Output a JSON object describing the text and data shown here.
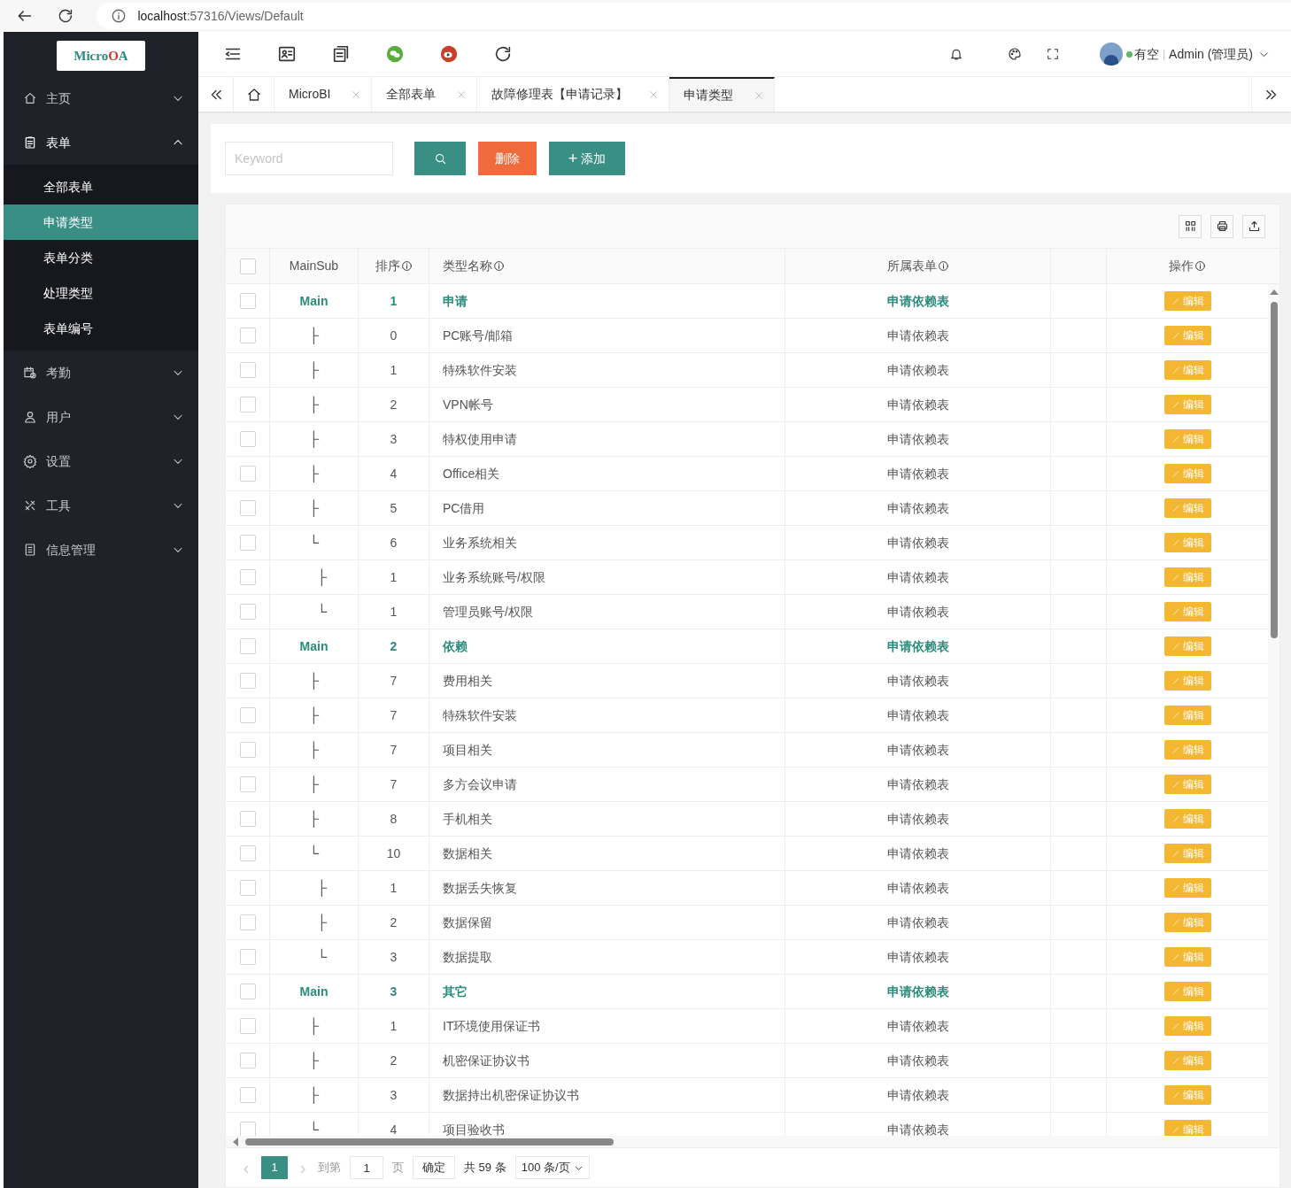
{
  "browser": {
    "url_host": "localhost",
    "url_rest": ":57316/Views/Default"
  },
  "logo": [
    {
      "text": "Micro",
      "color": "#2a8c7c"
    },
    {
      "text": "O",
      "color": "#d8352a"
    },
    {
      "text": "A",
      "color": "#2a8c7c"
    }
  ],
  "sidebar": {
    "items": [
      {
        "label": "主页",
        "expanded": false
      },
      {
        "label": "表单",
        "expanded": true,
        "children": [
          {
            "label": "全部表单",
            "selected": false
          },
          {
            "label": "申请类型",
            "selected": true
          },
          {
            "label": "表单分类",
            "selected": false
          },
          {
            "label": "处理类型",
            "selected": false
          },
          {
            "label": "表单编号",
            "selected": false
          }
        ]
      },
      {
        "label": "考勤",
        "expanded": false
      },
      {
        "label": "用户",
        "expanded": false
      },
      {
        "label": "设置",
        "expanded": false
      },
      {
        "label": "工具",
        "expanded": false
      },
      {
        "label": "信息管理",
        "expanded": false
      }
    ]
  },
  "header": {
    "status": "有空",
    "separator": "|",
    "user": "Admin (管理员)"
  },
  "tabs": [
    {
      "label": "MicroBI",
      "selected": false
    },
    {
      "label": "全部表单",
      "selected": false
    },
    {
      "label": "故障修理表【申请记录】",
      "selected": false
    },
    {
      "label": "申请类型",
      "selected": true
    }
  ],
  "search": {
    "placeholder": "Keyword"
  },
  "buttons": {
    "delete": "删除",
    "add": "添加",
    "add_symbol": "+"
  },
  "table": {
    "select_all_checked": false,
    "columns": [
      "MainSub",
      "排序",
      "类型名称",
      "所属表单",
      "操作"
    ],
    "rows": [
      {
        "branch": "Main",
        "sort": "1",
        "name": "申请",
        "form": "申请依赖表",
        "action": "编辑",
        "checked": false,
        "children": [
          {
            "branch": "├",
            "sort": "0",
            "name": "PC账号/邮箱",
            "form": "申请依赖表",
            "action": "编辑",
            "checked": false
          },
          {
            "branch": "├",
            "sort": "1",
            "name": "特殊软件安装",
            "form": "申请依赖表",
            "action": "编辑",
            "checked": false
          },
          {
            "branch": "├",
            "sort": "2",
            "name": "VPN帐号",
            "form": "申请依赖表",
            "action": "编辑",
            "checked": false
          },
          {
            "branch": "├",
            "sort": "3",
            "name": "特权使用申请",
            "form": "申请依赖表",
            "action": "编辑",
            "checked": false
          },
          {
            "branch": "├",
            "sort": "4",
            "name": "Office相关",
            "form": "申请依赖表",
            "action": "编辑",
            "checked": false
          },
          {
            "branch": "├",
            "sort": "5",
            "name": "PC借用",
            "form": "申请依赖表",
            "action": "编辑",
            "checked": false
          },
          {
            "branch": "└",
            "sort": "6",
            "name": "业务系统相关",
            "form": "申请依赖表",
            "action": "编辑",
            "checked": false,
            "children": [
              {
                "branch": "├",
                "sort": "1",
                "name": "业务系统账号/权限",
                "form": "申请依赖表",
                "action": "编辑",
                "checked": false
              },
              {
                "branch": "└",
                "sort": "1",
                "name": "管理员账号/权限",
                "form": "申请依赖表",
                "action": "编辑",
                "checked": false
              }
            ]
          }
        ]
      },
      {
        "branch": "Main",
        "sort": "2",
        "name": "依赖",
        "form": "申请依赖表",
        "action": "编辑",
        "checked": false,
        "children": [
          {
            "branch": "├",
            "sort": "7",
            "name": "费用相关",
            "form": "申请依赖表",
            "action": "编辑",
            "checked": false
          },
          {
            "branch": "├",
            "sort": "7",
            "name": "特殊软件安装",
            "form": "申请依赖表",
            "action": "编辑",
            "checked": false
          },
          {
            "branch": "├",
            "sort": "7",
            "name": "项目相关",
            "form": "申请依赖表",
            "action": "编辑",
            "checked": false
          },
          {
            "branch": "├",
            "sort": "7",
            "name": "多方会议申请",
            "form": "申请依赖表",
            "action": "编辑",
            "checked": false
          },
          {
            "branch": "├",
            "sort": "8",
            "name": "手机相关",
            "form": "申请依赖表",
            "action": "编辑",
            "checked": false
          },
          {
            "branch": "└",
            "sort": "10",
            "name": "数据相关",
            "form": "申请依赖表",
            "action": "编辑",
            "checked": false,
            "children": [
              {
                "branch": "├",
                "sort": "1",
                "name": "数据丢失恢复",
                "form": "申请依赖表",
                "action": "编辑",
                "checked": false
              },
              {
                "branch": "├",
                "sort": "2",
                "name": "数据保留",
                "form": "申请依赖表",
                "action": "编辑",
                "checked": false
              },
              {
                "branch": "└",
                "sort": "3",
                "name": "数据提取",
                "form": "申请依赖表",
                "action": "编辑",
                "checked": false
              }
            ]
          }
        ]
      },
      {
        "branch": "Main",
        "sort": "3",
        "name": "其它",
        "form": "申请依赖表",
        "action": "编辑",
        "checked": false,
        "children": [
          {
            "branch": "├",
            "sort": "1",
            "name": "IT环境使用保证书",
            "form": "申请依赖表",
            "action": "编辑",
            "checked": false
          },
          {
            "branch": "├",
            "sort": "2",
            "name": "机密保证协议书",
            "form": "申请依赖表",
            "action": "编辑",
            "checked": false
          },
          {
            "branch": "├",
            "sort": "3",
            "name": "数据持出机密保证协议书",
            "form": "申请依赖表",
            "action": "编辑",
            "checked": false
          },
          {
            "branch": "└",
            "sort": "4",
            "name": "项目验收书",
            "form": "申请依赖表",
            "action": "编辑",
            "checked": false
          }
        ]
      }
    ]
  },
  "pager": {
    "prev": "‹",
    "next": "›",
    "pages": [
      {
        "label": "1",
        "selected": true
      }
    ],
    "goto_label": "到第",
    "goto_value": "1",
    "page_unit": "页",
    "confirm": "确定",
    "total": "共 59 条",
    "page_size": "100 条/页"
  }
}
